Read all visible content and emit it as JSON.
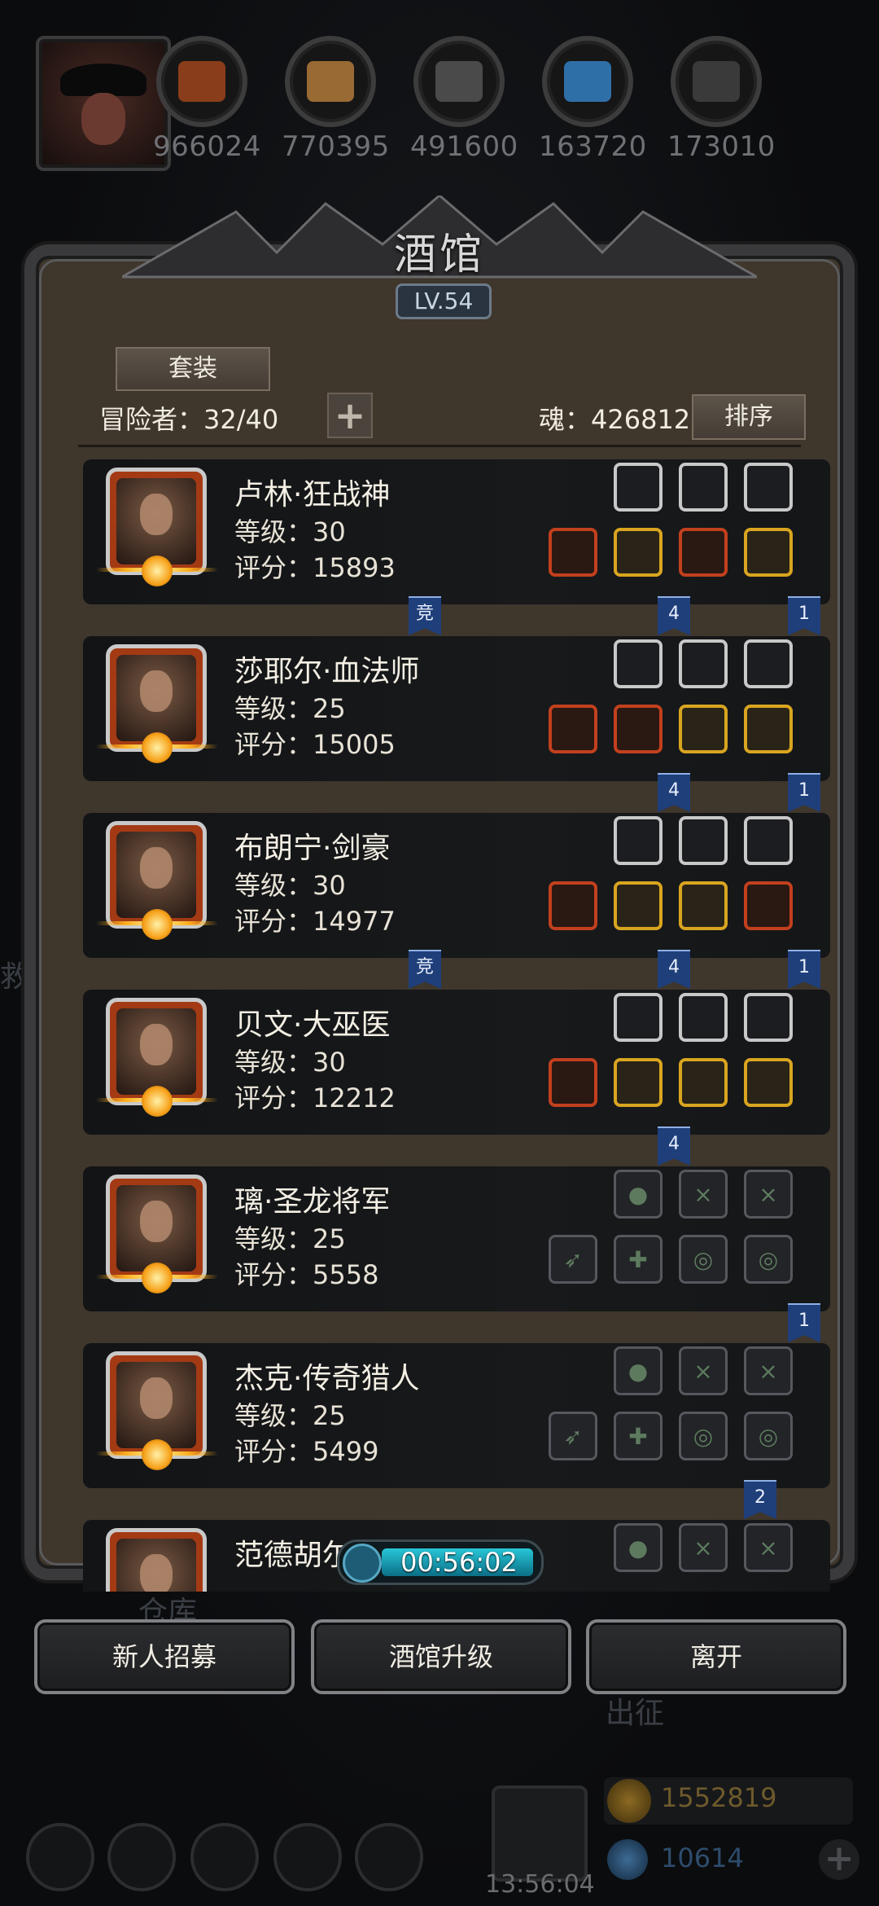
{
  "resources": [
    {
      "name": "meat",
      "value": "966024",
      "color": "#8a3d1a"
    },
    {
      "name": "wood",
      "value": "770395",
      "color": "#9a6a34"
    },
    {
      "name": "iron",
      "value": "491600",
      "color": "#4a4a4a"
    },
    {
      "name": "crystal",
      "value": "163720",
      "color": "#2f6fa8"
    },
    {
      "name": "stone",
      "value": "173010",
      "color": "#3a3a3a"
    }
  ],
  "tavern": {
    "title": "酒馆",
    "level": "LV.54",
    "set_button": "套装",
    "adventurers_label": "冒险者：32/40",
    "soul_label": "魂：426812",
    "sort_button": "排序"
  },
  "heroes": [
    {
      "name": "卢林·狂战神",
      "level": "等级：30",
      "score": "评分：15893",
      "top_slots": [
        "white",
        "white",
        "white"
      ],
      "bottom_slots": [
        "red",
        "gold",
        "red",
        "gold"
      ],
      "tags": [
        {
          "text": "竞",
          "col": 0
        },
        {
          "text": "4",
          "col": 1
        },
        {
          "text": "1",
          "col": 2
        }
      ]
    },
    {
      "name": "莎耶尔·血法师",
      "level": "等级：25",
      "score": "评分：15005",
      "top_slots": [
        "white",
        "white",
        "white"
      ],
      "bottom_slots": [
        "red",
        "red",
        "gold",
        "gold"
      ],
      "tags": [
        {
          "text": "4",
          "col": 1
        },
        {
          "text": "1",
          "col": 2
        }
      ]
    },
    {
      "name": "布朗宁·剑豪",
      "level": "等级：30",
      "score": "评分：14977",
      "top_slots": [
        "white",
        "white",
        "white"
      ],
      "bottom_slots": [
        "red",
        "gold",
        "gold",
        "red"
      ],
      "tags": [
        {
          "text": "竞",
          "col": 0
        },
        {
          "text": "4",
          "col": 1
        },
        {
          "text": "1",
          "col": 2
        }
      ]
    },
    {
      "name": "贝文·大巫医",
      "level": "等级：30",
      "score": "评分：12212",
      "top_slots": [
        "white",
        "white",
        "white"
      ],
      "bottom_slots": [
        "red",
        "gold",
        "gold",
        "gold"
      ],
      "tags": [
        {
          "text": "4",
          "col": 1
        }
      ]
    },
    {
      "name": "璃·圣龙将军",
      "level": "等级：25",
      "score": "评分：5558",
      "top_slots": [
        "empty",
        "empty",
        "empty"
      ],
      "bottom_slots": [
        "empty",
        "empty",
        "empty",
        "empty"
      ],
      "tags": [
        {
          "text": "1",
          "col": 2
        }
      ]
    },
    {
      "name": "杰克·传奇猎人",
      "level": "等级：25",
      "score": "评分：5499",
      "top_slots": [
        "empty",
        "empty",
        "empty"
      ],
      "bottom_slots": [
        "empty",
        "empty",
        "empty",
        "empty"
      ],
      "tags": [
        {
          "text": "2",
          "col": 3
        }
      ]
    },
    {
      "name": "范德胡尔·火刑官",
      "level": "",
      "score": "",
      "top_slots": [
        "empty",
        "empty",
        "empty"
      ],
      "bottom_slots": [],
      "tags": []
    }
  ],
  "timer": "00:56:02",
  "actions": {
    "recruit": "新人招募",
    "upgrade": "酒馆升级",
    "leave": "离开"
  },
  "background": {
    "warehouse": "仓库",
    "expedition": "出征",
    "rescue": "救"
  },
  "bottom": {
    "gold": "1552819",
    "gems": "10614",
    "clock": "13:56:04"
  }
}
